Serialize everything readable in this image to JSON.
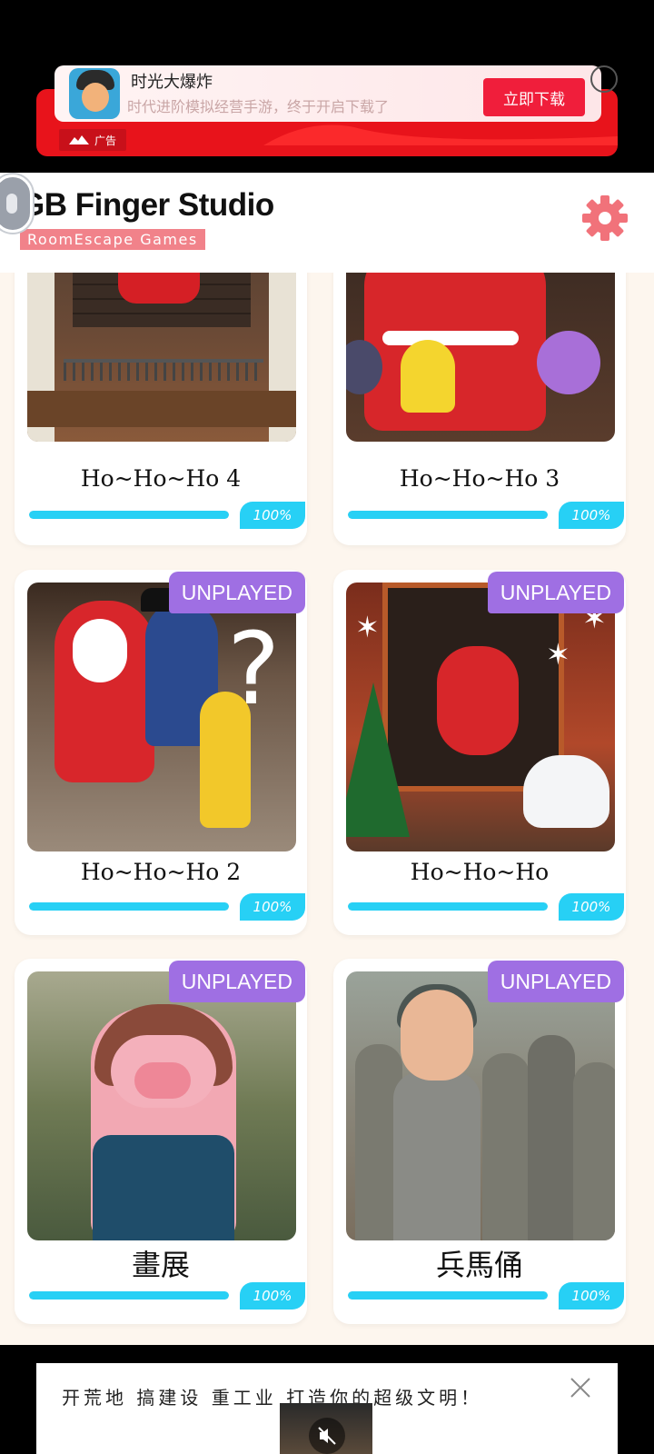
{
  "top_ad": {
    "app_name": "时光大爆炸",
    "tagline": "时代进阶模拟经营手游，终于开启下载了",
    "cta": "立即下载",
    "ad_label": "广告"
  },
  "header": {
    "title": "GB Finger Studio",
    "subtitle": "RoomEscape Games"
  },
  "games": [
    {
      "title": "Ho~Ho~Ho 4",
      "progress_label": "100%",
      "progress": 1.0,
      "badge": ""
    },
    {
      "title": "Ho~Ho~Ho 3",
      "progress_label": "100%",
      "progress": 1.0,
      "badge": ""
    },
    {
      "title": "Ho~Ho~Ho 2",
      "progress_label": "100%",
      "progress": 1.0,
      "badge": "UNPLAYED"
    },
    {
      "title": "Ho~Ho~Ho",
      "progress_label": "100%",
      "progress": 1.0,
      "badge": "UNPLAYED"
    },
    {
      "title": "畫展",
      "progress_label": "100%",
      "progress": 1.0,
      "badge": "UNPLAYED"
    },
    {
      "title": "兵馬俑",
      "progress_label": "100%",
      "progress": 1.0,
      "badge": "UNPLAYED"
    }
  ],
  "bottom_ad": {
    "text": "开荒地  搞建设  重工业  打造你的超级文明！"
  },
  "colors": {
    "accent_cyan": "#27d0f5",
    "badge_purple": "#9f6fe3",
    "gear_coral": "#f1727a",
    "content_bg": "#fdf6ee"
  },
  "icons": {
    "settings": "gear-icon",
    "close": "close-icon",
    "mute": "mute-icon"
  }
}
